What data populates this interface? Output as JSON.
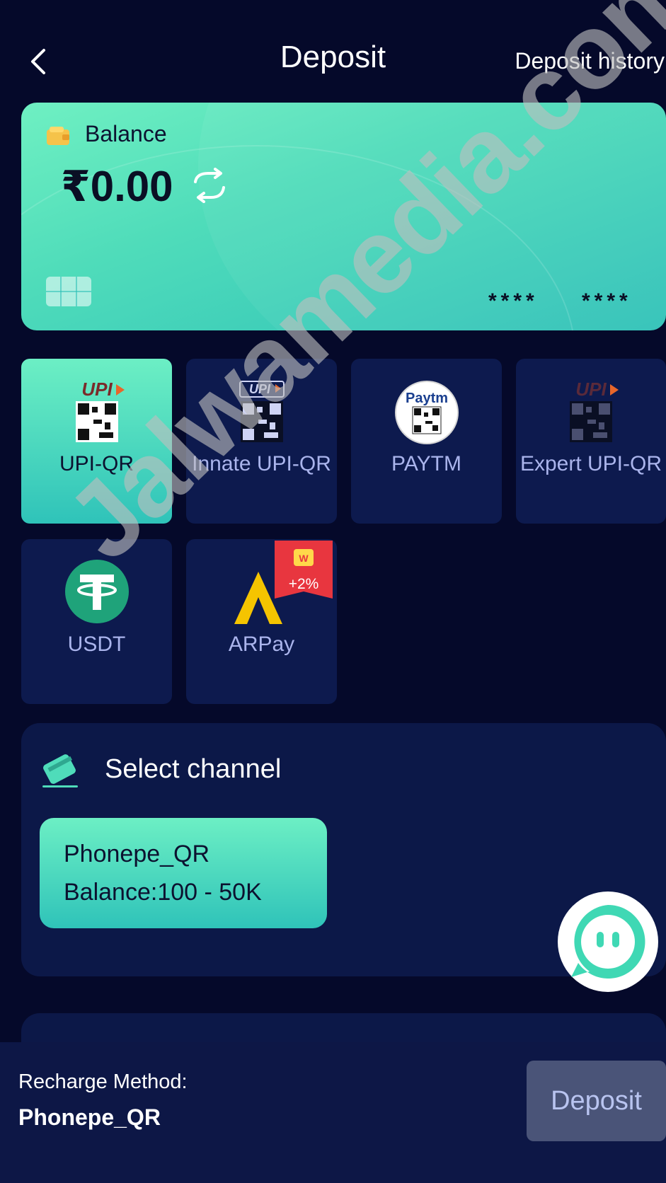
{
  "header": {
    "title": "Deposit",
    "history_link": "Deposit history"
  },
  "balance_card": {
    "label": "Balance",
    "amount": "₹0.00",
    "masked_groups": [
      "****",
      "****"
    ]
  },
  "methods": [
    {
      "label": "UPI-QR",
      "active": true,
      "icon": "upi-qr-icon",
      "logo_text": "UPI"
    },
    {
      "label": "Innate UPI-QR",
      "active": false,
      "icon": "upi-qr-icon",
      "logo_text": "UPI"
    },
    {
      "label": "PAYTM",
      "active": false,
      "icon": "paytm-qr-icon",
      "logo_text": "Paytm"
    },
    {
      "label": "Expert UPI-QR",
      "active": false,
      "icon": "upi-qr-icon",
      "logo_text": "UPI"
    },
    {
      "label": "USDT",
      "active": false,
      "icon": "tether-icon",
      "logo_text": "T"
    },
    {
      "label": "ARPay",
      "active": false,
      "icon": "arpay-icon",
      "badge": "+2%"
    }
  ],
  "channel": {
    "title": "Select channel",
    "options": [
      {
        "name": "Phonepe_QR",
        "range": "Balance:100 - 50K"
      }
    ]
  },
  "bottom_bar": {
    "caption": "Recharge Method:",
    "value": "Phonepe_QR",
    "deposit_label": "Deposit"
  },
  "watermark": "Jalwamedia.com",
  "colors": {
    "background": "#05092a",
    "accent_green": "#5ee6c0",
    "tile_bg": "#0d1a4e",
    "button_disabled": "#4a5478"
  }
}
